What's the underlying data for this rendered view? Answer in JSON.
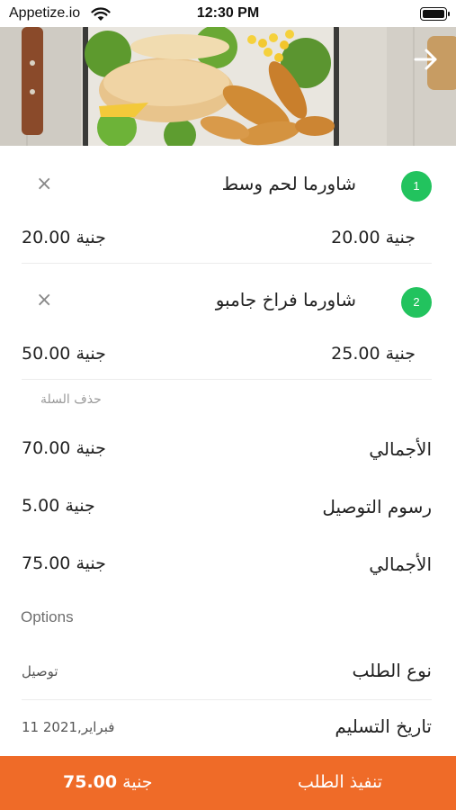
{
  "status_bar": {
    "carrier": "Appetize.io",
    "time": "12:30 PM",
    "icons": [
      "wifi-icon",
      "battery-icon"
    ]
  },
  "header": {
    "back_icon": "arrow-right-icon"
  },
  "cart": {
    "items": [
      {
        "index": "1",
        "name": "شاورما لحم وسط",
        "unit_price": "20.00 جنية",
        "line_total": "20.00 جنية",
        "remove_icon": "close-icon"
      },
      {
        "index": "2",
        "name": "شاورما فراخ جامبو",
        "unit_price": "25.00 جنية",
        "line_total": "50.00 جنية",
        "remove_icon": "close-icon"
      }
    ],
    "clear_label": "حذف السلة"
  },
  "summary": {
    "subtotal_label": "الأجمالي",
    "subtotal_value": "70.00 جنية",
    "delivery_label": "رسوم التوصيل",
    "delivery_value": "5.00 جنية",
    "total_label": "الأجمالي",
    "total_value": "75.00 جنية"
  },
  "options": {
    "section_label": "Options",
    "order_type_label": "نوع الطلب",
    "order_type_value": "توصيل",
    "delivery_date_label": "تاريخ التسليم",
    "delivery_date_value": "11 فبراير,2021"
  },
  "checkout": {
    "label": "تنفيذ الطلب",
    "amount": "75.00",
    "currency": "جنية"
  },
  "colors": {
    "accent": "#ef6b28",
    "badge": "#22c35e"
  }
}
